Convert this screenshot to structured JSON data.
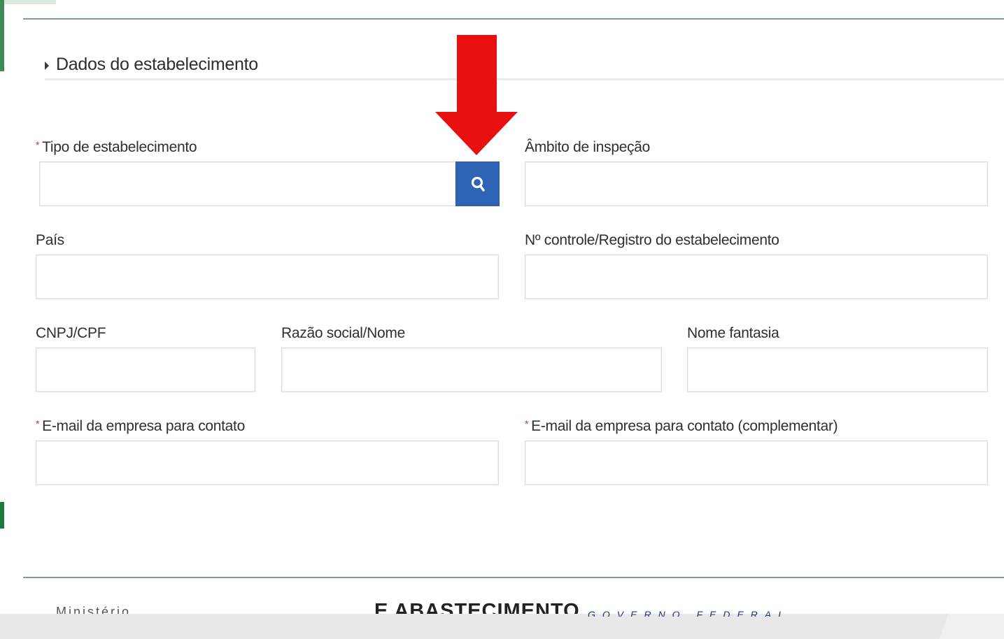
{
  "section": {
    "title": "Dados do estabelecimento"
  },
  "fields": {
    "tipo": {
      "label": "Tipo de estabelecimento",
      "required_mark": "*",
      "value": ""
    },
    "ambito": {
      "label": "Âmbito de inspeção",
      "value": ""
    },
    "pais": {
      "label": "País",
      "value": ""
    },
    "controle": {
      "label": "Nº controle/Registro do estabelecimento",
      "value": ""
    },
    "cnpj": {
      "label": "CNPJ/CPF",
      "value": ""
    },
    "razao": {
      "label": "Razão social/Nome",
      "value": ""
    },
    "fantasia": {
      "label": "Nome fantasia",
      "value": ""
    },
    "email": {
      "label": "E-mail da empresa para contato",
      "required_mark": "*",
      "value": ""
    },
    "email_comp": {
      "label": "E-mail da empresa para contato (complementar)",
      "required_mark": "*",
      "value": ""
    }
  },
  "search_button": {
    "icon": "search-icon"
  },
  "annotation": {
    "icon": "red-arrow-down-icon",
    "color": "#e81010"
  },
  "footer": {
    "main_text": "E ABASTECIMENTO",
    "sub_text": "GOVERNO FEDERAL",
    "left_text": "Ministério"
  },
  "colors": {
    "accent_green": "#1d7a3a",
    "button_blue": "#2f63b6",
    "required_red": "#c23b3b"
  }
}
